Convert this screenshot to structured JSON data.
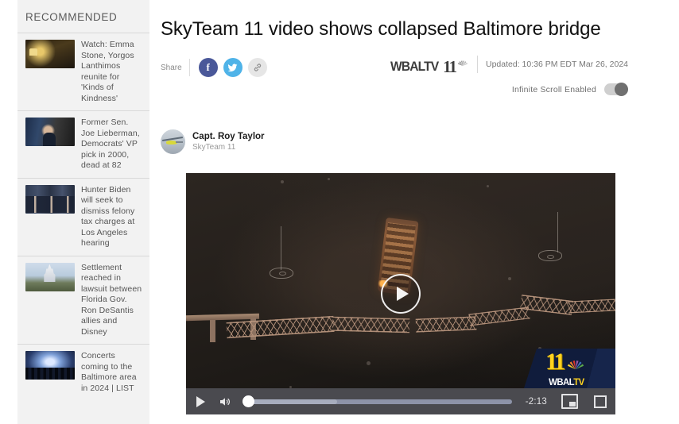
{
  "sidebar": {
    "title": "RECOMMENDED",
    "items": [
      {
        "text": "Watch: Emma Stone, Yorgos Lanthimos reunite for 'Kinds of Kindness'",
        "thumb": "emma"
      },
      {
        "text": "Former Sen. Joe Lieberman, Democrats' VP pick in 2000, dead at 82",
        "thumb": "lieberman"
      },
      {
        "text": "Hunter Biden will seek to dismiss felony tax charges at Los Angeles hearing",
        "thumb": "biden"
      },
      {
        "text": "Settlement reached in lawsuit between Florida Gov. Ron DeSantis allies and Disney",
        "thumb": "disney"
      },
      {
        "text": "Concerts coming to the Baltimore area in 2024 | LIST",
        "thumb": "concert"
      }
    ]
  },
  "article": {
    "headline": "SkyTeam 11 video shows collapsed Baltimore bridge",
    "share_label": "Share",
    "share_buttons": [
      {
        "name": "facebook-share-button",
        "glyph": "f"
      },
      {
        "name": "twitter-share-button",
        "glyph": "⁂"
      },
      {
        "name": "copy-link-button",
        "glyph": "🔗"
      }
    ],
    "brand": {
      "word": "WBALTV",
      "channel": "11",
      "peacock_icon": "nbc-peacock-icon"
    },
    "updated": "Updated: 10:36 PM EDT Mar 26, 2024",
    "infinite_scroll_label": "Infinite Scroll Enabled",
    "infinite_scroll_on": true,
    "byline": {
      "name": "Capt. Roy Taylor",
      "affiliation": "SkyTeam 11",
      "avatar_icon": "helicopter-avatar"
    }
  },
  "player": {
    "play_overlay_icon": "play-circle-icon",
    "controls": {
      "play_icon": "play-icon",
      "volume_icon": "volume-on-icon",
      "time_remaining": "-2:13",
      "pip_icon": "picture-in-picture-icon",
      "fullscreen_icon": "fullscreen-icon",
      "progress_percent": 0,
      "buffered_percent": 35
    },
    "watermark": {
      "channel": "11",
      "word": "WBAL",
      "word_accent": "TV",
      "peacock_icon": "nbc-peacock-icon"
    }
  },
  "colors": {
    "facebook": "#4a5899",
    "twitter": "#4fb3e8",
    "link_chip": "#e6e6e6",
    "sidebar_bg": "#f2f2f2",
    "control_bar": "#4a4a4f",
    "bug_yellow": "#ffd21f",
    "bug_navy": "#101c3c"
  }
}
